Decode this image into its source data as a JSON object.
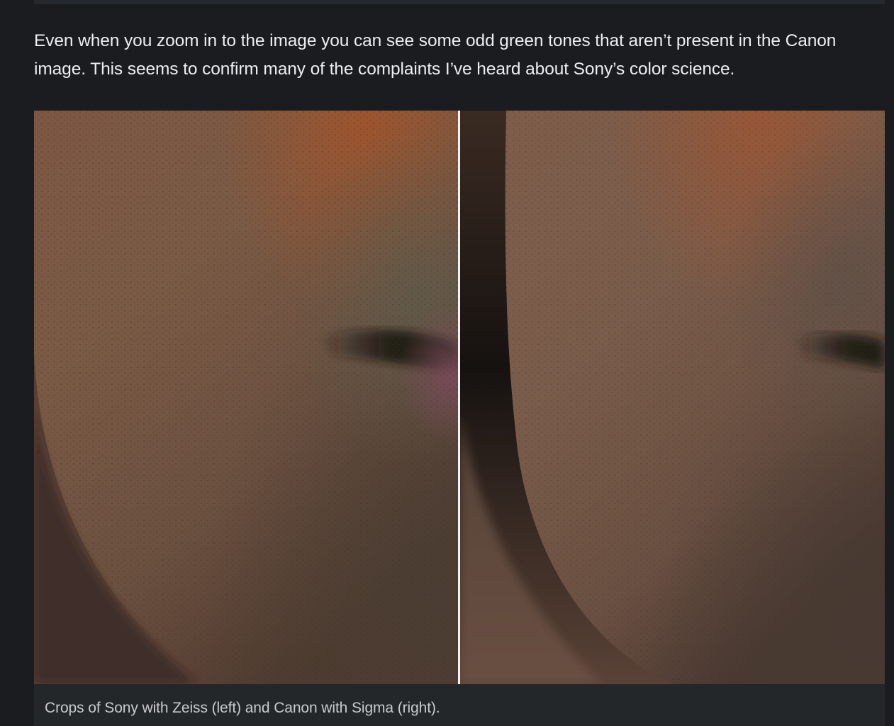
{
  "article": {
    "paragraph": "Even when you zoom in to the image you can see some odd green tones that aren’t present in the Canon image. This seems to confirm many of the complaints I’ve heard about Sony’s color science."
  },
  "figure": {
    "caption": "Crops of Sony with Zeiss (left) and Canon with Sigma (right).",
    "left_photo": "skin-closeup-sony-zeiss",
    "right_photo": "skin-closeup-canon-sigma"
  },
  "colors": {
    "page_background": "#1a1c1f",
    "text": "#eceff1",
    "caption_text": "#c8cbce",
    "caption_background": "#24272a",
    "divider": "#f2f2f2"
  }
}
